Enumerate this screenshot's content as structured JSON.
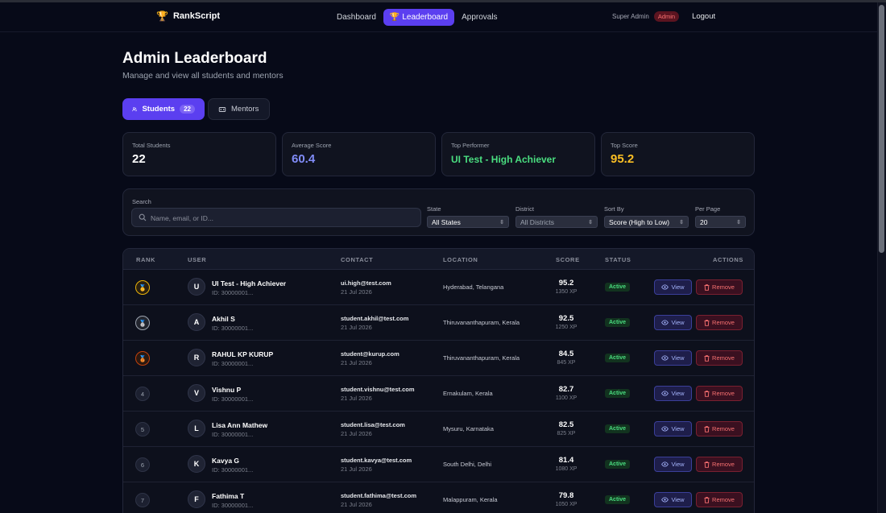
{
  "nav": {
    "brand": "RankScript",
    "links": [
      "Dashboard",
      "Leaderboard",
      "Approvals"
    ],
    "user_role": "Super Admin",
    "badge": "Admin",
    "logout": "Logout"
  },
  "header": {
    "title": "Admin Leaderboard",
    "subtitle": "Manage and view all students and mentors"
  },
  "tabs": {
    "students": {
      "label": "Students",
      "count": "22"
    },
    "mentors": {
      "label": "Mentors"
    }
  },
  "stats": [
    {
      "label": "Total Students",
      "value": "22",
      "color": "#ffffff"
    },
    {
      "label": "Average Score",
      "value": "60.4",
      "color": "#818cf8"
    },
    {
      "label": "Top Performer",
      "value": "UI Test - High Achiever",
      "color": "#4ade80"
    },
    {
      "label": "Top Score",
      "value": "95.2",
      "color": "#fbbf24"
    }
  ],
  "filters": {
    "search_label": "Search",
    "search_placeholder": "Name, email, or ID...",
    "state_label": "State",
    "state_value": "All States",
    "district_label": "District",
    "district_value": "All Districts",
    "sort_label": "Sort By",
    "sort_value": "Score (High to Low)",
    "perpage_label": "Per Page",
    "perpage_value": "20"
  },
  "table": {
    "headers": {
      "rank": "RANK",
      "user": "USER",
      "contact": "CONTACT",
      "location": "LOCATION",
      "score": "SCORE",
      "status": "STATUS",
      "actions": "ACTIONS"
    },
    "view_label": "View",
    "remove_label": "Remove",
    "rows": [
      {
        "rank": "1",
        "medal": "gold",
        "initial": "U",
        "name": "UI Test - High Achiever",
        "id": "ID: 30000001...",
        "email": "ui.high@test.com",
        "date": "21 Jul 2026",
        "location": "Hyderabad, Telangana",
        "score": "95.2",
        "xp": "1350 XP",
        "status": "Active"
      },
      {
        "rank": "2",
        "medal": "silver",
        "initial": "A",
        "name": "Akhil S",
        "id": "ID: 30000001...",
        "email": "student.akhil@test.com",
        "date": "21 Jul 2026",
        "location": "Thiruvananthapuram, Kerala",
        "score": "92.5",
        "xp": "1250 XP",
        "status": "Active"
      },
      {
        "rank": "3",
        "medal": "bronze",
        "initial": "R",
        "name": "RAHUL KP KURUP",
        "id": "ID: 30000001...",
        "email": "student@kurup.com",
        "date": "21 Jul 2026",
        "location": "Thiruvananthapuram, Kerala",
        "score": "84.5",
        "xp": "845 XP",
        "status": "Active"
      },
      {
        "rank": "4",
        "medal": "",
        "initial": "V",
        "name": "Vishnu P",
        "id": "ID: 30000001...",
        "email": "student.vishnu@test.com",
        "date": "21 Jul 2026",
        "location": "Ernakulam, Kerala",
        "score": "82.7",
        "xp": "1100 XP",
        "status": "Active"
      },
      {
        "rank": "5",
        "medal": "",
        "initial": "L",
        "name": "Lisa Ann Mathew",
        "id": "ID: 30000001...",
        "email": "student.lisa@test.com",
        "date": "21 Jul 2026",
        "location": "Mysuru, Karnataka",
        "score": "82.5",
        "xp": "825 XP",
        "status": "Active"
      },
      {
        "rank": "6",
        "medal": "",
        "initial": "K",
        "name": "Kavya G",
        "id": "ID: 30000001...",
        "email": "student.kavya@test.com",
        "date": "21 Jul 2026",
        "location": "South Delhi, Delhi",
        "score": "81.4",
        "xp": "1080 XP",
        "status": "Active"
      },
      {
        "rank": "7",
        "medal": "",
        "initial": "F",
        "name": "Fathima T",
        "id": "ID: 30000001...",
        "email": "student.fathima@test.com",
        "date": "21 Jul 2026",
        "location": "Malappuram, Kerala",
        "score": "79.8",
        "xp": "1050 XP",
        "status": "Active"
      }
    ]
  }
}
